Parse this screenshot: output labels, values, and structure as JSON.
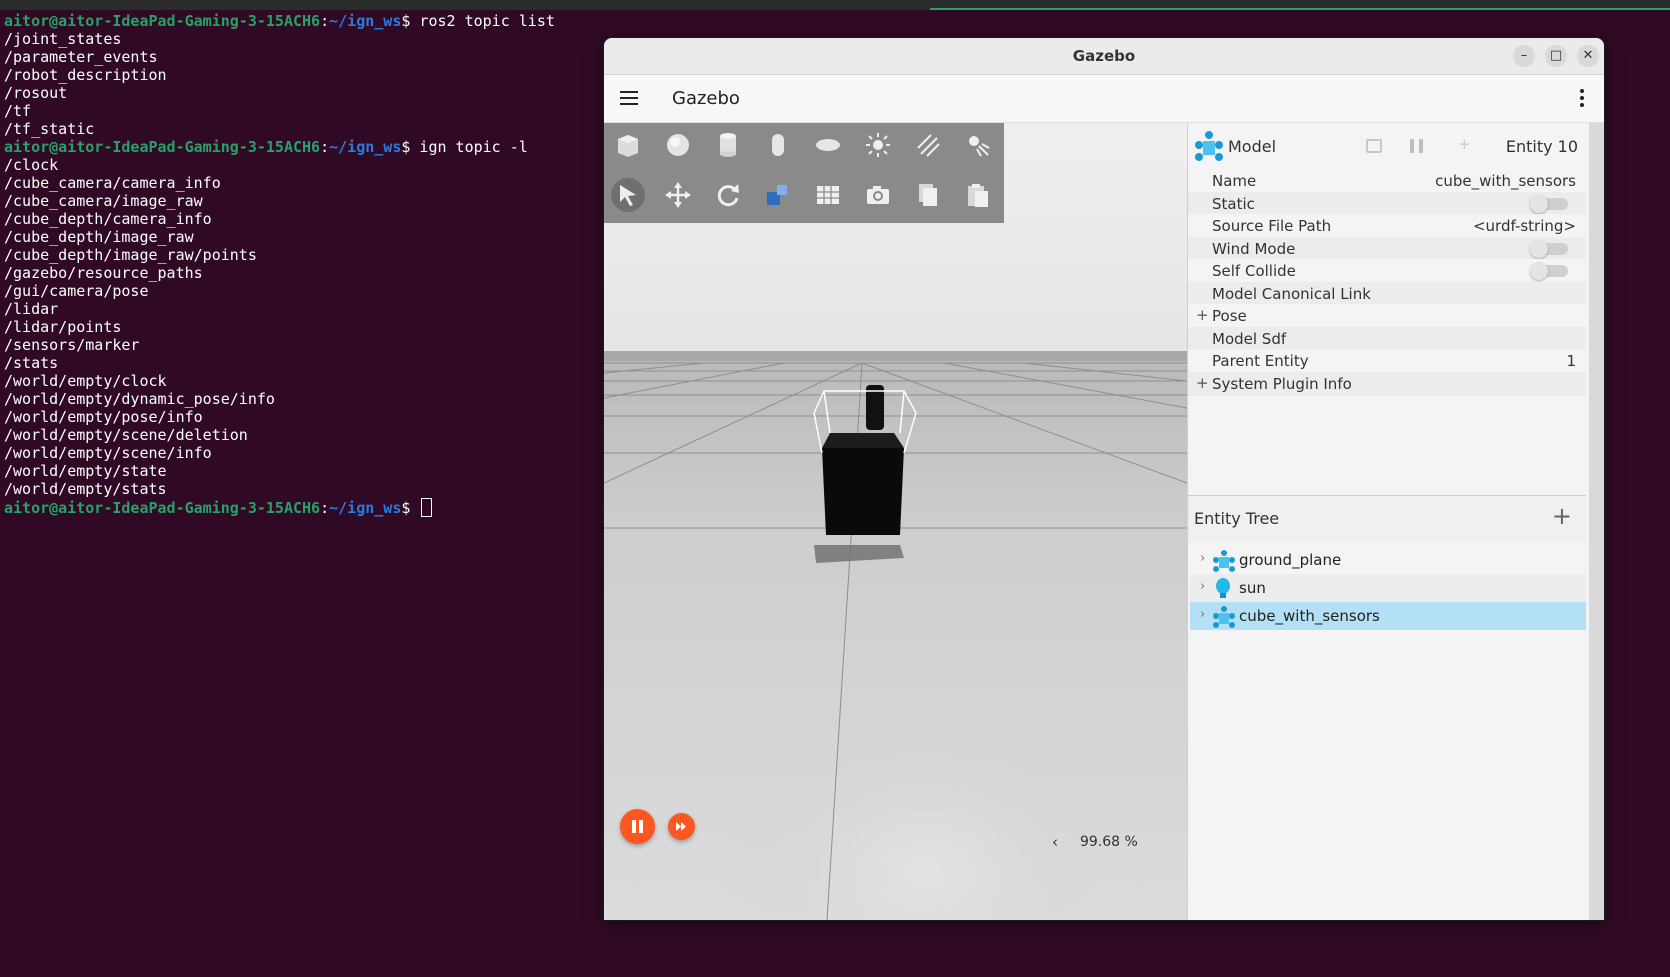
{
  "terminal": {
    "prompt_user": "aitor@aitor-IdeaPad-Gaming-3-15ACH6",
    "prompt_path": "~/ign_ws",
    "cmd1": "ros2 topic list",
    "ros2_topics": [
      "/joint_states",
      "/parameter_events",
      "/robot_description",
      "/rosout",
      "/tf",
      "/tf_static"
    ],
    "cmd2": "ign topic -l",
    "ign_topics": [
      "/clock",
      "/cube_camera/camera_info",
      "/cube_camera/image_raw",
      "/cube_depth/camera_info",
      "/cube_depth/image_raw",
      "/cube_depth/image_raw/points",
      "/gazebo/resource_paths",
      "/gui/camera/pose",
      "/lidar",
      "/lidar/points",
      "/sensors/marker",
      "/stats",
      "/world/empty/clock",
      "/world/empty/dynamic_pose/info",
      "/world/empty/pose/info",
      "/world/empty/scene/deletion",
      "/world/empty/scene/info",
      "/world/empty/state",
      "/world/empty/stats"
    ]
  },
  "window": {
    "title": "Gazebo",
    "app_title": "Gazebo"
  },
  "viewport": {
    "rtf": "99.68 %",
    "toolbar_icons": [
      "box-icon",
      "sphere-icon",
      "cylinder-icon",
      "capsule-icon",
      "ellipsoid-icon",
      "sun-light-icon",
      "directional-light-icon",
      "spot-light-icon",
      "select-icon",
      "translate-icon",
      "rotate-icon",
      "scale-icon",
      "grid-icon",
      "camera-icon",
      "copy-icon",
      "paste-icon"
    ]
  },
  "component_inspector": {
    "type_label": "Model",
    "entity_label": "Entity 10",
    "rows": [
      {
        "key": "Name",
        "value": "cube_with_sensors"
      },
      {
        "key": "Static",
        "toggle": false
      },
      {
        "key": "Source File Path",
        "value": "<urdf-string>"
      },
      {
        "key": "Wind Mode",
        "toggle": false
      },
      {
        "key": "Self Collide",
        "toggle": false
      },
      {
        "key": "Model Canonical Link",
        "value": ""
      },
      {
        "key": "Pose",
        "value": "",
        "expand": "+"
      },
      {
        "key": "Model Sdf",
        "value": ""
      },
      {
        "key": "Parent Entity",
        "value": "1"
      },
      {
        "key": "System Plugin Info",
        "value": "",
        "expand": "+"
      }
    ]
  },
  "entity_tree": {
    "title": "Entity Tree",
    "items": [
      {
        "label": "ground_plane",
        "icon": "model-icon",
        "selected": false
      },
      {
        "label": "sun",
        "icon": "light-bulb-icon",
        "selected": false
      },
      {
        "label": "cube_with_sensors",
        "icon": "model-icon",
        "selected": true
      }
    ]
  },
  "colors": {
    "terminal_bg": "#300a24",
    "prompt_user": "#26a269",
    "prompt_path": "#2a7bde",
    "play_button": "#fe5722",
    "selection": "#b3e0f5"
  }
}
